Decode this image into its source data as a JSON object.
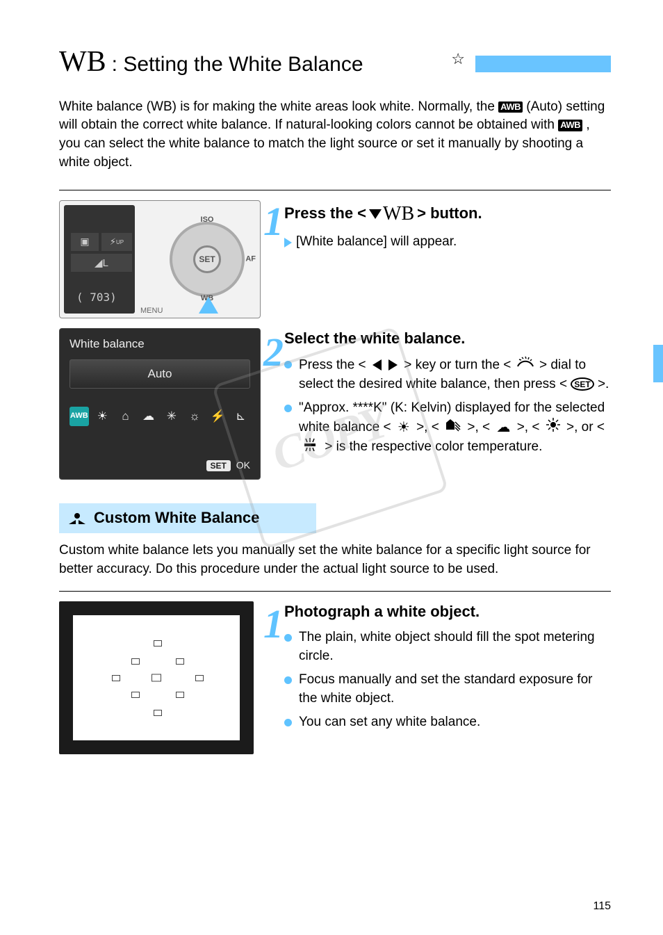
{
  "header": {
    "wb_prefix": "WB",
    "title_suffix": ": Setting the White Balance",
    "star": "☆"
  },
  "intro": {
    "p1a": "White balance (WB) is for making the white areas look white. Normally, the ",
    "p1b": " (Auto) setting will obtain the correct white balance. If natural-looking colors cannot be obtained with ",
    "p1c": ", you can select the white balance to match the light source or set it manually by shooting a white object."
  },
  "step1": {
    "head_pre": "Press the <",
    "head_mid": "",
    "head_post": "> button.",
    "body": "[White balance] will appear."
  },
  "step2": {
    "head": "Select the white balance.",
    "b1a": "Press the <",
    "b1b": "> key or turn the <",
    "b1c": "> dial to select the desired white balance, then press <",
    "b1d": ">.",
    "b2a": "\"Approx. ****K\" (K: Kelvin) displayed for the selected white balance <",
    "b2b": ">, <",
    "b2c": ">, <",
    "b2d": ">, <",
    "b2e": ">, or <",
    "b2f": "> is the respective color temperature."
  },
  "lcd": {
    "counter": "( 703)",
    "set": "SET",
    "iso": "ISO",
    "af": "AF",
    "wb": "WB",
    "menu": "MENU",
    "chip3": "L"
  },
  "wb_screen": {
    "title": "White balance",
    "mode": "Auto",
    "awb": "AWB",
    "set": "SET",
    "ok": "OK"
  },
  "custom": {
    "head": " Custom White Balance",
    "p1": "Custom white balance lets you manually set the white balance for a specific light source for better accuracy. Do this procedure under the actual light source to be used."
  },
  "step1b": {
    "head": "Photograph a white object.",
    "b1": "The plain, white object should fill the spot metering circle.",
    "b2": "Focus manually and set the standard exposure for the white object.",
    "b3": "You can set any white balance."
  },
  "page_num": "115",
  "watermark": "COPY"
}
